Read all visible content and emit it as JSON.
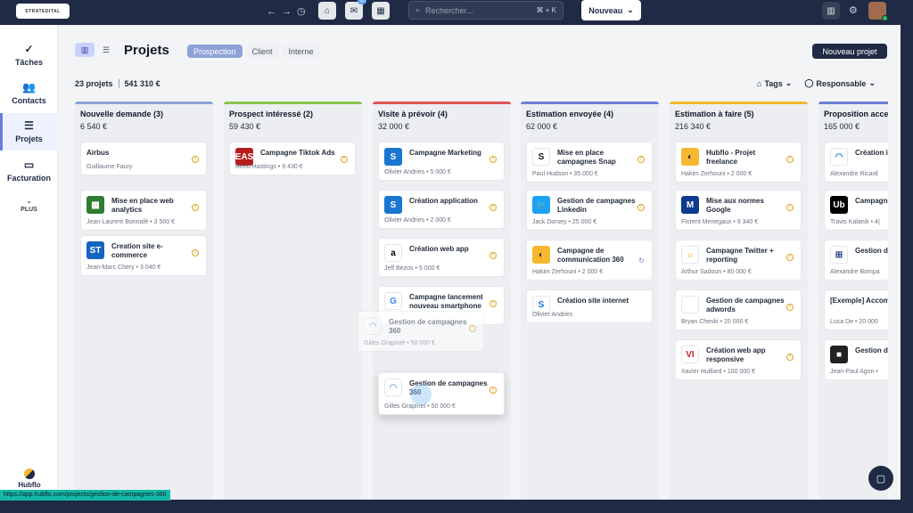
{
  "topbar": {
    "logo_text": "STRATEDITAL",
    "search_placeholder": "Rechercher...",
    "search_shortcut": "⌘ + K",
    "mail_badge": "12",
    "new_button": "Nouveau"
  },
  "sidebar": {
    "items": [
      {
        "label": "Tâches",
        "icon": "check-icon"
      },
      {
        "label": "Contacts",
        "icon": "users-icon"
      },
      {
        "label": "Projets",
        "icon": "list-icon"
      },
      {
        "label": "Facturation",
        "icon": "banknote-icon"
      }
    ],
    "more_label": "PLUS",
    "brand": "Hubflo"
  },
  "header": {
    "title": "Projets",
    "tabs": [
      "Prospection",
      "Client",
      "Interne"
    ],
    "active_tab": "Prospection",
    "new_project": "Nouveau projet",
    "project_count": "23 projets",
    "total_amount": "541 310 €",
    "tags_label": "Tags",
    "owner_label": "Responsable"
  },
  "columns": [
    {
      "title": "Nouvelle demande (3)",
      "total": "6 540 €",
      "color": "#8fa2d8",
      "cards": [
        {
          "title": "Airbus",
          "meta": "Guillaume Faury"
        },
        {
          "title": "Mise en place web analytics",
          "meta": "Jean-Laurent Bonnafé • 3 500 €"
        },
        {
          "title": "Creation site e-commerce",
          "meta": "Jean-Marc Chery • 3 040 €"
        }
      ]
    },
    {
      "title": "Prospect intéressé (2)",
      "total": "59 430 €",
      "color": "#8bc34a",
      "cards": [
        {
          "title": "Campagne Tiktok Ads",
          "meta": "Reed Hastings • 9 430 €"
        }
      ]
    },
    {
      "title": "Visite à prévoir (4)",
      "total": "32 000 €",
      "color": "#e05252",
      "cards": [
        {
          "title": "Campagne Marketing",
          "meta": "Olivier Andries • 5 000 €"
        },
        {
          "title": "Création application",
          "meta": "Olivier Andries • 2 000 €"
        },
        {
          "title": "Création web app",
          "meta": "Jeff Bezos • 5 000 €"
        },
        {
          "title": "Campagne lancement nouveau smartphone",
          "meta": ""
        }
      ],
      "ghost_card": {
        "title": "Gestion de campagnes 360",
        "meta": "Gilles Grapinet • 50 000 €"
      },
      "drag_card": {
        "title": "Gestion de campagnes 360",
        "meta": "Gilles Grapinet • 50 000 €"
      }
    },
    {
      "title": "Estimation envoyée (4)",
      "total": "62 000 €",
      "color": "#6b7fd7",
      "cards": [
        {
          "title": "Mise en place campagnes Snap",
          "meta": "Paul Hudson • 35 000 €"
        },
        {
          "title": "Gestion de campagnes Linkedin",
          "meta": "Jack Dorsey • 25 000 €"
        },
        {
          "title": "Campagne de communication 360",
          "meta": "Hakim Zerhouni • 2 000 €"
        },
        {
          "title": "Création site internet",
          "meta": "Olivier Andries"
        }
      ]
    },
    {
      "title": "Estimation à faire (5)",
      "total": "216 340 €",
      "color": "#f5b82e",
      "cards": [
        {
          "title": "Hubflo - Projet freelance",
          "meta": "Hakim Zerhouni • 2 000 €"
        },
        {
          "title": "Mise aux normes Google",
          "meta": "Florent Menegaux • 9 340 €"
        },
        {
          "title": "Campagne Twitter + reporting",
          "meta": "Arthur Sadoun • 80 000 €"
        },
        {
          "title": "Gestion de campagnes adwords",
          "meta": "Bryan Cheski • 25 000 €"
        },
        {
          "title": "Création web app responsive",
          "meta": "Xavier Huillard • 100 000 €"
        }
      ]
    },
    {
      "title": "Proposition acce",
      "total": "165 000 €",
      "color": "#6b7fd7",
      "cards": [
        {
          "title": "Création ic",
          "meta": "Alexandre Ricard"
        },
        {
          "title": "Campagne",
          "meta": "Travis Kalanik • 4("
        },
        {
          "title": "Gestion de adwords",
          "meta": "Alexandre Bompa"
        },
        {
          "title": "[Exemple] Accompagneme",
          "meta": "Luca De • 20 000"
        },
        {
          "title": "Gestion de Google",
          "meta": "Jean-Paul Agon •"
        }
      ]
    }
  ],
  "status_url": "https://app.hubflo.com/projects/gestion-de-campagnes-360"
}
